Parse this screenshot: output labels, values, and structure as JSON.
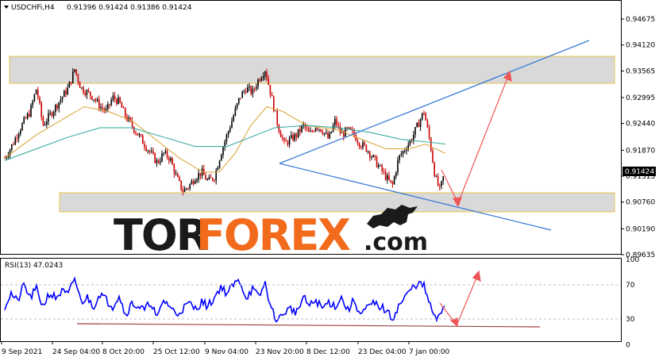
{
  "header": {
    "symbol": "USDCHFi,H4",
    "ohlc": "0.91396 0.91424 0.91386 0.91424"
  },
  "rsi_header": "RSI(13) 47.0243",
  "watermark": {
    "part1": "TOR",
    "part2": "FOREX",
    "part3": ".com"
  },
  "colors": {
    "bull_candle": "#000000",
    "bear_candle": "#cc0000",
    "ma_fast": "#d9a330",
    "ma_slow": "#2aa79b",
    "trendline": "#3a7bd5",
    "arrow": "#ee5555",
    "zone_fill": "#d9d9d9",
    "zone_border": "#e6c34a",
    "rsi_line": "#0000ff",
    "rsi_support": "#a04040",
    "watermark_dark": "#1a1a1a",
    "watermark_orange": "#f26a1b"
  },
  "chart_data": [
    {
      "type": "candlestick",
      "title": "USDCHFi,H4",
      "y_ticks": [
        "0.94675",
        "0.94120",
        "0.93565",
        "0.92995",
        "0.92440",
        "0.91870",
        "0.91315",
        "0.90760",
        "0.90190",
        "0.89635"
      ],
      "ylim": [
        0.89635,
        0.94675
      ],
      "x_ticks": [
        "9 Sep 2021",
        "24 Sep 04:00",
        "8 Oct 20:00",
        "25 Oct 12:00",
        "9 Nov 04:00",
        "23 Nov 20:00",
        "8 Dec 12:00",
        "23 Dec 04:00",
        "7 Jan 00:00"
      ],
      "current_price": "0.91424",
      "close_path": [
        [
          0,
          0.917
        ],
        [
          10,
          0.92
        ],
        [
          18,
          0.923
        ],
        [
          25,
          0.925
        ],
        [
          32,
          0.927
        ],
        [
          40,
          0.932
        ],
        [
          48,
          0.924
        ],
        [
          56,
          0.926
        ],
        [
          64,
          0.928
        ],
        [
          72,
          0.93
        ],
        [
          80,
          0.932
        ],
        [
          88,
          0.936
        ],
        [
          96,
          0.932
        ],
        [
          104,
          0.931
        ],
        [
          112,
          0.93
        ],
        [
          120,
          0.928
        ],
        [
          128,
          0.927
        ],
        [
          136,
          0.93
        ],
        [
          144,
          0.929
        ],
        [
          152,
          0.926
        ],
        [
          160,
          0.924
        ],
        [
          168,
          0.922
        ],
        [
          176,
          0.92
        ],
        [
          184,
          0.918
        ],
        [
          192,
          0.916
        ],
        [
          200,
          0.918
        ],
        [
          208,
          0.917
        ],
        [
          216,
          0.913
        ],
        [
          224,
          0.91
        ],
        [
          232,
          0.911
        ],
        [
          240,
          0.913
        ],
        [
          248,
          0.914
        ],
        [
          256,
          0.912
        ],
        [
          264,
          0.913
        ],
        [
          272,
          0.918
        ],
        [
          280,
          0.922
        ],
        [
          288,
          0.926
        ],
        [
          296,
          0.93
        ],
        [
          304,
          0.932
        ],
        [
          312,
          0.931
        ],
        [
          320,
          0.934
        ],
        [
          328,
          0.936
        ],
        [
          336,
          0.93
        ],
        [
          344,
          0.924
        ],
        [
          352,
          0.92
        ],
        [
          360,
          0.921
        ],
        [
          368,
          0.922
        ],
        [
          376,
          0.924
        ],
        [
          384,
          0.922
        ],
        [
          392,
          0.924
        ],
        [
          400,
          0.923
        ],
        [
          408,
          0.921
        ],
        [
          416,
          0.925
        ],
        [
          424,
          0.922
        ],
        [
          432,
          0.923
        ],
        [
          440,
          0.922
        ],
        [
          448,
          0.92
        ],
        [
          456,
          0.919
        ],
        [
          464,
          0.917
        ],
        [
          472,
          0.915
        ],
        [
          480,
          0.913
        ],
        [
          488,
          0.911
        ],
        [
          496,
          0.917
        ],
        [
          504,
          0.919
        ],
        [
          512,
          0.921
        ],
        [
          520,
          0.924
        ],
        [
          528,
          0.927
        ],
        [
          536,
          0.92
        ],
        [
          542,
          0.913
        ],
        [
          548,
          0.91
        ],
        [
          554,
          0.914
        ]
      ],
      "ma_fast": [
        [
          0,
          0.917
        ],
        [
          40,
          0.922
        ],
        [
          80,
          0.926
        ],
        [
          100,
          0.928
        ],
        [
          130,
          0.927
        ],
        [
          160,
          0.925
        ],
        [
          190,
          0.921
        ],
        [
          220,
          0.917
        ],
        [
          250,
          0.914
        ],
        [
          270,
          0.914
        ],
        [
          290,
          0.918
        ],
        [
          310,
          0.924
        ],
        [
          330,
          0.928
        ],
        [
          350,
          0.927
        ],
        [
          380,
          0.924
        ],
        [
          420,
          0.923
        ],
        [
          450,
          0.921
        ],
        [
          480,
          0.919
        ],
        [
          510,
          0.919
        ],
        [
          530,
          0.92
        ],
        [
          555,
          0.918
        ]
      ],
      "ma_slow": [
        [
          0,
          0.9165
        ],
        [
          40,
          0.919
        ],
        [
          80,
          0.9215
        ],
        [
          120,
          0.9235
        ],
        [
          160,
          0.9235
        ],
        [
          200,
          0.9215
        ],
        [
          240,
          0.9195
        ],
        [
          280,
          0.9195
        ],
        [
          310,
          0.9215
        ],
        [
          340,
          0.9235
        ],
        [
          380,
          0.924
        ],
        [
          420,
          0.9235
        ],
        [
          460,
          0.9225
        ],
        [
          500,
          0.921
        ],
        [
          530,
          0.9205
        ],
        [
          555,
          0.92
        ]
      ],
      "resistance_zone": [
        0.934,
        0.939
      ],
      "support_zone": [
        0.9065,
        0.9095
      ]
    },
    {
      "type": "line",
      "title": "RSI(13) 47.0243",
      "y_ticks": [
        "100",
        "70",
        "30",
        "0"
      ],
      "ylim": [
        0,
        100
      ],
      "series": [
        {
          "values": [
            [
              0,
              45
            ],
            [
              8,
              60
            ],
            [
              16,
              50
            ],
            [
              24,
              70
            ],
            [
              32,
              55
            ],
            [
              40,
              65
            ],
            [
              48,
              45
            ],
            [
              56,
              60
            ],
            [
              64,
              55
            ],
            [
              72,
              62
            ],
            [
              80,
              58
            ],
            [
              88,
              78
            ],
            [
              96,
              50
            ],
            [
              104,
              55
            ],
            [
              112,
              45
            ],
            [
              120,
              60
            ],
            [
              128,
              52
            ],
            [
              136,
              45
            ],
            [
              144,
              58
            ],
            [
              152,
              35
            ],
            [
              160,
              48
            ],
            [
              168,
              45
            ],
            [
              176,
              40
            ],
            [
              184,
              50
            ],
            [
              192,
              30
            ],
            [
              200,
              52
            ],
            [
              208,
              45
            ],
            [
              216,
              35
            ],
            [
              224,
              42
            ],
            [
              232,
              48
            ],
            [
              240,
              42
            ],
            [
              248,
              50
            ],
            [
              256,
              45
            ],
            [
              264,
              55
            ],
            [
              272,
              68
            ],
            [
              280,
              60
            ],
            [
              288,
              70
            ],
            [
              296,
              75
            ],
            [
              304,
              55
            ],
            [
              312,
              65
            ],
            [
              320,
              55
            ],
            [
              328,
              72
            ],
            [
              336,
              40
            ],
            [
              344,
              28
            ],
            [
              352,
              38
            ],
            [
              360,
              42
            ],
            [
              368,
              38
            ],
            [
              376,
              55
            ],
            [
              384,
              45
            ],
            [
              392,
              52
            ],
            [
              400,
              42
            ],
            [
              408,
              50
            ],
            [
              416,
              45
            ],
            [
              424,
              55
            ],
            [
              432,
              40
            ],
            [
              440,
              52
            ],
            [
              448,
              35
            ],
            [
              456,
              42
            ],
            [
              464,
              48
            ],
            [
              472,
              45
            ],
            [
              480,
              40
            ],
            [
              488,
              30
            ],
            [
              496,
              45
            ],
            [
              504,
              55
            ],
            [
              512,
              65
            ],
            [
              520,
              72
            ],
            [
              528,
              68
            ],
            [
              536,
              45
            ],
            [
              542,
              30
            ],
            [
              548,
              32
            ],
            [
              554,
              48
            ]
          ]
        }
      ],
      "support_line": [
        [
          97,
          25
        ],
        [
          680,
          22
        ]
      ]
    }
  ]
}
